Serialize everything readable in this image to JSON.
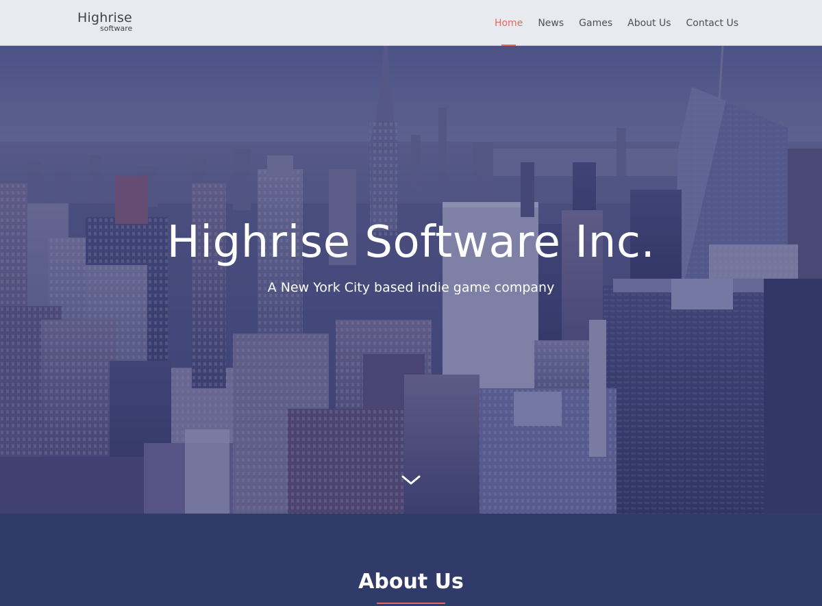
{
  "brand": {
    "main": "Highrise",
    "sub": "software"
  },
  "nav": {
    "items": [
      {
        "label": "Home",
        "active": true
      },
      {
        "label": "News",
        "active": false
      },
      {
        "label": "Games",
        "active": false
      },
      {
        "label": "About Us",
        "active": false
      },
      {
        "label": "Contact Us",
        "active": false
      }
    ]
  },
  "hero": {
    "title": "Highrise Software Inc.",
    "subtitle": "A New York City based indie game company",
    "scroll_icon": "chevron-down-icon"
  },
  "about": {
    "title": "About Us"
  },
  "colors": {
    "accent": "#e3685f",
    "navy": "#313b6a",
    "nav_bg": "#e8eaef"
  }
}
